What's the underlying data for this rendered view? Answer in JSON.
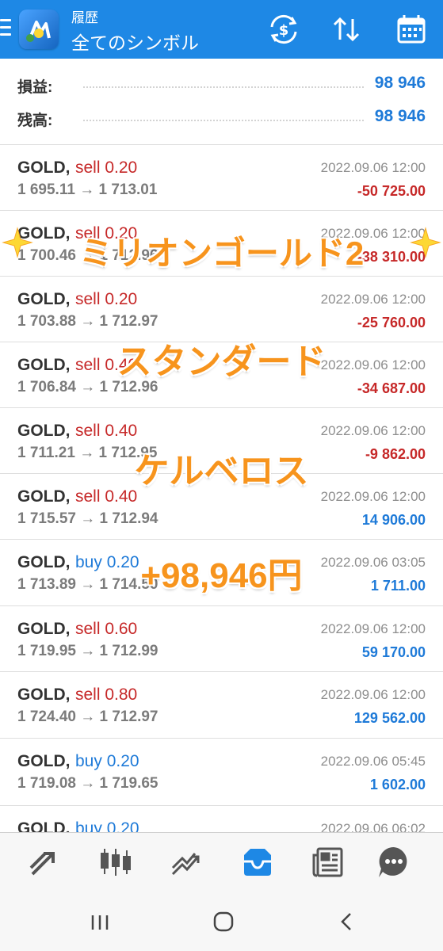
{
  "header": {
    "title": "履歴",
    "subtitle": "全てのシンボル"
  },
  "summary": [
    {
      "label": "損益:",
      "value": "98 946"
    },
    {
      "label": "残高:",
      "value": "98 946"
    }
  ],
  "trades": [
    {
      "symbol": "GOLD,",
      "type": "sell 0.20",
      "side": "sell",
      "prices": "1 695.11 → 1 713.01",
      "time": "2022.09.06 12:00",
      "profit": "-50 725.00"
    },
    {
      "symbol": "GOLD,",
      "type": "sell 0.20",
      "side": "sell",
      "prices": "1 700.46 → 1 712.96",
      "time": "2022.09.06 12:00",
      "profit": "-38 310.00"
    },
    {
      "symbol": "GOLD,",
      "type": "sell 0.20",
      "side": "sell",
      "prices": "1 703.88 → 1 712.97",
      "time": "2022.09.06 12:00",
      "profit": "-25 760.00"
    },
    {
      "symbol": "GOLD,",
      "type": "sell 0.40",
      "side": "sell",
      "prices": "1 706.84 → 1 712.96",
      "time": "2022.09.06 12:00",
      "profit": "-34 687.00"
    },
    {
      "symbol": "GOLD,",
      "type": "sell 0.40",
      "side": "sell",
      "prices": "1 711.21 → 1 712.95",
      "time": "2022.09.06 12:00",
      "profit": "-9 862.00"
    },
    {
      "symbol": "GOLD,",
      "type": "sell 0.40",
      "side": "sell",
      "prices": "1 715.57 → 1 712.94",
      "time": "2022.09.06 12:00",
      "profit": "14 906.00"
    },
    {
      "symbol": "GOLD,",
      "type": "buy 0.20",
      "side": "buy",
      "prices": "1 713.89 → 1 714.50",
      "time": "2022.09.06 03:05",
      "profit": "1 711.00"
    },
    {
      "symbol": "GOLD,",
      "type": "sell 0.60",
      "side": "sell",
      "prices": "1 719.95 → 1 712.99",
      "time": "2022.09.06 12:00",
      "profit": "59 170.00"
    },
    {
      "symbol": "GOLD,",
      "type": "sell 0.80",
      "side": "sell",
      "prices": "1 724.40 → 1 712.97",
      "time": "2022.09.06 12:00",
      "profit": "129 562.00"
    },
    {
      "symbol": "GOLD,",
      "type": "buy 0.20",
      "side": "buy",
      "prices": "1 719.08 → 1 719.65",
      "time": "2022.09.06 05:45",
      "profit": "1 602.00"
    },
    {
      "symbol": "GOLD,",
      "type": "buy 0.20",
      "side": "buy",
      "prices": "",
      "time": "2022.09.06 06:02",
      "profit": ""
    }
  ],
  "overlay": {
    "line1": "ミリオンゴールド2",
    "line2": "スタンダード",
    "line3": "ケルベロス",
    "line4": "+98,946円",
    "color": "#f7941d"
  },
  "colors": {
    "header": "#1e88e5",
    "sell": "#c62828",
    "buy": "#1e7ad8"
  },
  "icons": {
    "header": [
      "menu-icon",
      "app-logo",
      "currency-exchange-icon",
      "sort-icon",
      "calendar-icon"
    ],
    "bottom_nav": [
      "quotes-icon",
      "chart-icon",
      "trade-icon",
      "history-icon",
      "news-icon",
      "chat-icon"
    ],
    "system": [
      "recent-apps-icon",
      "home-icon",
      "back-icon"
    ]
  },
  "bottom_nav": {
    "active": "history-icon"
  }
}
